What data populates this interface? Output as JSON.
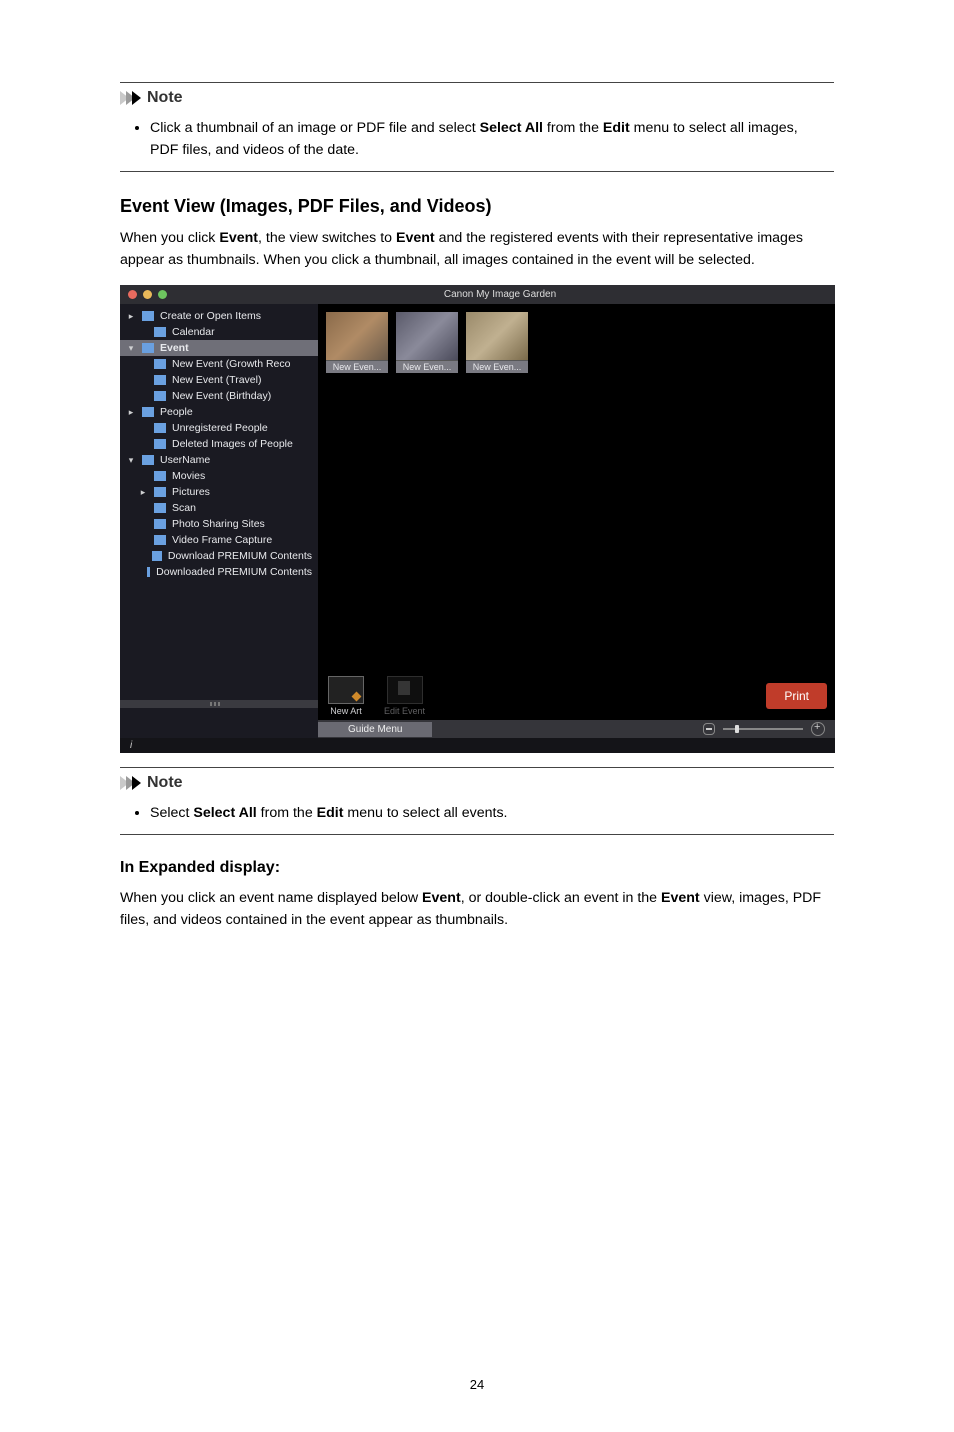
{
  "note1": {
    "title": "Note",
    "text_pre": "Click a thumbnail of an image or PDF file and select ",
    "select_all": "Select All",
    "text_mid": " from the ",
    "edit": "Edit",
    "text_post": " menu to select all images, PDF files, and videos of the date."
  },
  "section": {
    "heading": "Event View (Images, PDF Files, and Videos)",
    "p_pre": "When you click ",
    "p_b1": "Event",
    "p_mid1": ", the view switches to ",
    "p_b2": "Event",
    "p_post": " and the registered events with their representative images appear as thumbnails. When you click a thumbnail, all images contained in the event will be selected."
  },
  "app": {
    "title": "Canon My Image Garden",
    "sidebar": {
      "items": [
        {
          "lvl": 1,
          "txt": "Create or Open Items",
          "arrow": "▸",
          "ico": "grey"
        },
        {
          "lvl": 2,
          "txt": "Calendar",
          "arrow": "",
          "ico": "teal"
        },
        {
          "lvl": 1,
          "txt": "Event",
          "arrow": "▾",
          "ico": "pink",
          "sel": true
        },
        {
          "lvl": 2,
          "txt": "New Event (Growth Reco",
          "arrow": "",
          "ico": "pink"
        },
        {
          "lvl": 2,
          "txt": "New Event (Travel)",
          "arrow": "",
          "ico": "gold"
        },
        {
          "lvl": 2,
          "txt": "New Event (Birthday)",
          "arrow": "",
          "ico": "teal"
        },
        {
          "lvl": 1,
          "txt": "People",
          "arrow": "▸",
          "ico": "grey"
        },
        {
          "lvl": 2,
          "txt": "Unregistered People",
          "arrow": "",
          "ico": "grey"
        },
        {
          "lvl": 2,
          "txt": "Deleted Images of People",
          "arrow": "",
          "ico": "grey"
        },
        {
          "lvl": 1,
          "txt": "UserName",
          "arrow": "▾",
          "ico": "purple"
        },
        {
          "lvl": 2,
          "txt": "Movies",
          "arrow": "",
          "ico": "folder"
        },
        {
          "lvl": 2,
          "txt": "Pictures",
          "arrow": "▸",
          "ico": "folder"
        },
        {
          "lvl": 2,
          "txt": "Scan",
          "arrow": "",
          "ico": "green"
        },
        {
          "lvl": 2,
          "txt": "Photo Sharing Sites",
          "arrow": "",
          "ico": "teal"
        },
        {
          "lvl": 2,
          "txt": "Video Frame Capture",
          "arrow": "",
          "ico": "gold"
        },
        {
          "lvl": 2,
          "txt": "Download PREMIUM Contents",
          "arrow": "",
          "ico": "purple"
        },
        {
          "lvl": 2,
          "txt": "Downloaded PREMIUM Contents",
          "arrow": "",
          "ico": "folder"
        }
      ],
      "footer_badge": "i"
    },
    "thumbs": [
      {
        "label": "New Even..."
      },
      {
        "label": "New Even..."
      },
      {
        "label": "New Even..."
      }
    ],
    "tools": {
      "new_art": "New Art",
      "edit_event": "Edit Event"
    },
    "print": "Print",
    "guide_menu": "Guide Menu",
    "strip_i": "i"
  },
  "note2": {
    "title": "Note",
    "pre": "Select ",
    "b1": "Select All",
    "mid": " from the ",
    "b2": "Edit",
    "post": " menu to select all events."
  },
  "expand": {
    "heading": "In Expanded display:",
    "p_pre": "When you click an event name displayed below ",
    "p_b1": "Event",
    "p_mid": ", or double-click an event in the ",
    "p_b2": "Event",
    "p_post": " view, images, PDF files, and videos contained in the event appear as thumbnails."
  },
  "page_number": "24"
}
